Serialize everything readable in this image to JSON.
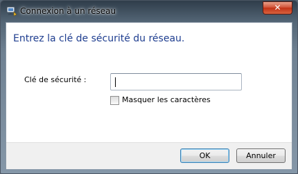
{
  "window": {
    "title": "Connexion à un réseau",
    "close_label": "✕"
  },
  "dialog": {
    "heading": "Entrez la clé de sécurité du réseau.",
    "security_key": {
      "label": "Clé de sécurité :",
      "value": ""
    },
    "mask_characters": {
      "label": "Masquer les caractères",
      "checked": false
    }
  },
  "buttons": {
    "ok_label": "OK",
    "cancel_label": "Annuler"
  },
  "icons": {
    "app": "network-connect-icon",
    "close": "close-icon"
  }
}
